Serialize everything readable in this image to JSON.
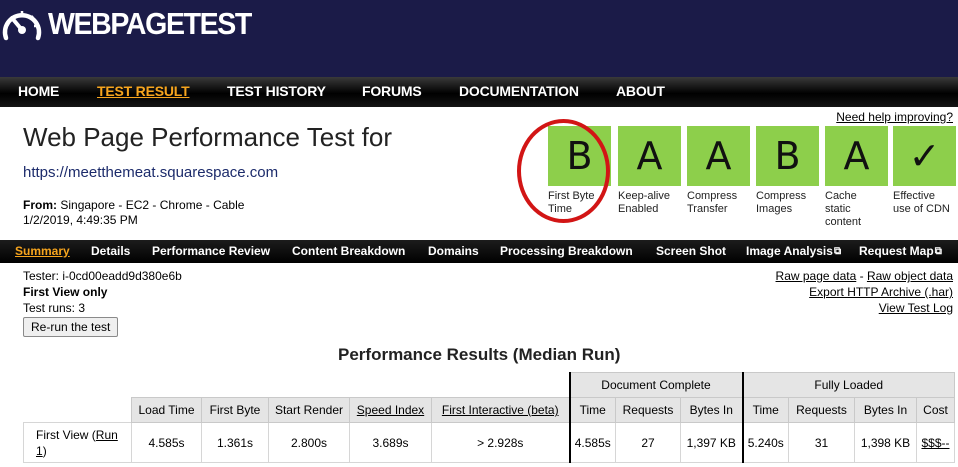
{
  "logo": {
    "text": "WEBPAGETEST",
    "icon": "speedometer-icon"
  },
  "nav": {
    "items": [
      {
        "label": "HOME",
        "active": false
      },
      {
        "label": "TEST RESULT",
        "active": true
      },
      {
        "label": "TEST HISTORY",
        "active": false
      },
      {
        "label": "FORUMS",
        "active": false
      },
      {
        "label": "DOCUMENTATION",
        "active": false
      },
      {
        "label": "ABOUT",
        "active": false
      }
    ]
  },
  "help_link": "Need help improving?",
  "title": "Web Page Performance Test for",
  "url": "https://meetthemeat.squarespace.com",
  "from": {
    "label": "From:",
    "value": "Singapore - EC2 - Chrome - Cable",
    "date": "1/2/2019, 4:49:35 PM"
  },
  "grades": [
    {
      "grade": "B",
      "label": "First Byte Time"
    },
    {
      "grade": "A",
      "label": "Keep-alive Enabled"
    },
    {
      "grade": "A",
      "label": "Compress Transfer"
    },
    {
      "grade": "B",
      "label": "Compress Images"
    },
    {
      "grade": "A",
      "label": "Cache static content"
    },
    {
      "grade": "✓",
      "label": "Effective use of CDN"
    }
  ],
  "subnav": {
    "items": [
      {
        "label": "Summary",
        "active": true
      },
      {
        "label": "Details"
      },
      {
        "label": "Performance Review"
      },
      {
        "label": "Content Breakdown"
      },
      {
        "label": "Domains"
      },
      {
        "label": "Processing Breakdown"
      },
      {
        "label": "Screen Shot"
      },
      {
        "label": "Image Analysis",
        "external_icon": "external-link-icon"
      },
      {
        "label": "Request Map",
        "external_icon": "external-link-icon"
      }
    ]
  },
  "tester": {
    "tester": "Tester: i-0cd00eadd9d380e6b",
    "view": "First View only",
    "runs": "Test runs: 3",
    "rerun_button": "Re-run the test"
  },
  "side_links": {
    "raw_page": "Raw page data",
    "sep": " - ",
    "raw_object": "Raw object data",
    "export": "Export HTTP Archive (.har)",
    "log": "View Test Log"
  },
  "results": {
    "title": "Performance Results (Median Run)",
    "group_document": "Document Complete",
    "group_fully": "Fully Loaded",
    "headers": {
      "load_time": "Load Time",
      "first_byte": "First Byte",
      "start_render": "Start Render",
      "speed_index": "Speed Index",
      "first_interactive": "First Interactive (beta)",
      "doc_time": "Time",
      "doc_requests": "Requests",
      "doc_bytes": "Bytes In",
      "full_time": "Time",
      "full_requests": "Requests",
      "full_bytes": "Bytes In",
      "cost": "Cost"
    },
    "row": {
      "label_prefix": "First View (",
      "run_word": "Run",
      "run_num": "1",
      "label_suffix": ")",
      "load_time": "4.585s",
      "first_byte": "1.361s",
      "start_render": "2.800s",
      "speed_index": "3.689s",
      "first_interactive": "> 2.928s",
      "doc_time": "4.585s",
      "doc_requests": "27",
      "doc_bytes": "1,397 KB",
      "full_time": "5.240s",
      "full_requests": "31",
      "full_bytes": "1,398 KB",
      "cost": "$$$--"
    }
  }
}
